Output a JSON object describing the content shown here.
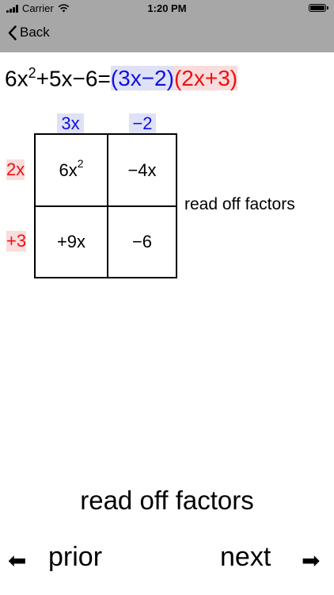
{
  "status_bar": {
    "carrier": "Carrier",
    "time": "1:20 PM"
  },
  "nav_bar": {
    "back_label": "Back"
  },
  "equation": {
    "lhs_a": "6x",
    "lhs_exp": "2",
    "lhs_b": "+5x−6=",
    "factor1": "(3x−2)",
    "factor2": "(2x+3)"
  },
  "grid": {
    "col_headers": [
      "3x",
      "−2"
    ],
    "row_headers": [
      "2x",
      "+3"
    ],
    "cells": {
      "r1c1_base": "6x",
      "r1c1_exp": "2",
      "r1c2": "−4x",
      "r2c1": "+9x",
      "r2c2": "−6"
    },
    "side_note": "read off factors"
  },
  "bottom": {
    "caption": "read off factors",
    "prior_label": "prior",
    "next_label": "next",
    "prior_arrow": "⬅",
    "next_arrow": "➡"
  },
  "colors": {
    "nav_bar": "#a7a7a7",
    "blue": "#1010e0",
    "red": "#ef1010",
    "blue_highlight": "#dfe1f6",
    "red_highlight": "#f9dcdc"
  },
  "icons": [
    "signal-icon",
    "wifi-icon",
    "battery-icon",
    "chevron-left-icon",
    "left-arrow-icon",
    "right-arrow-icon"
  ]
}
